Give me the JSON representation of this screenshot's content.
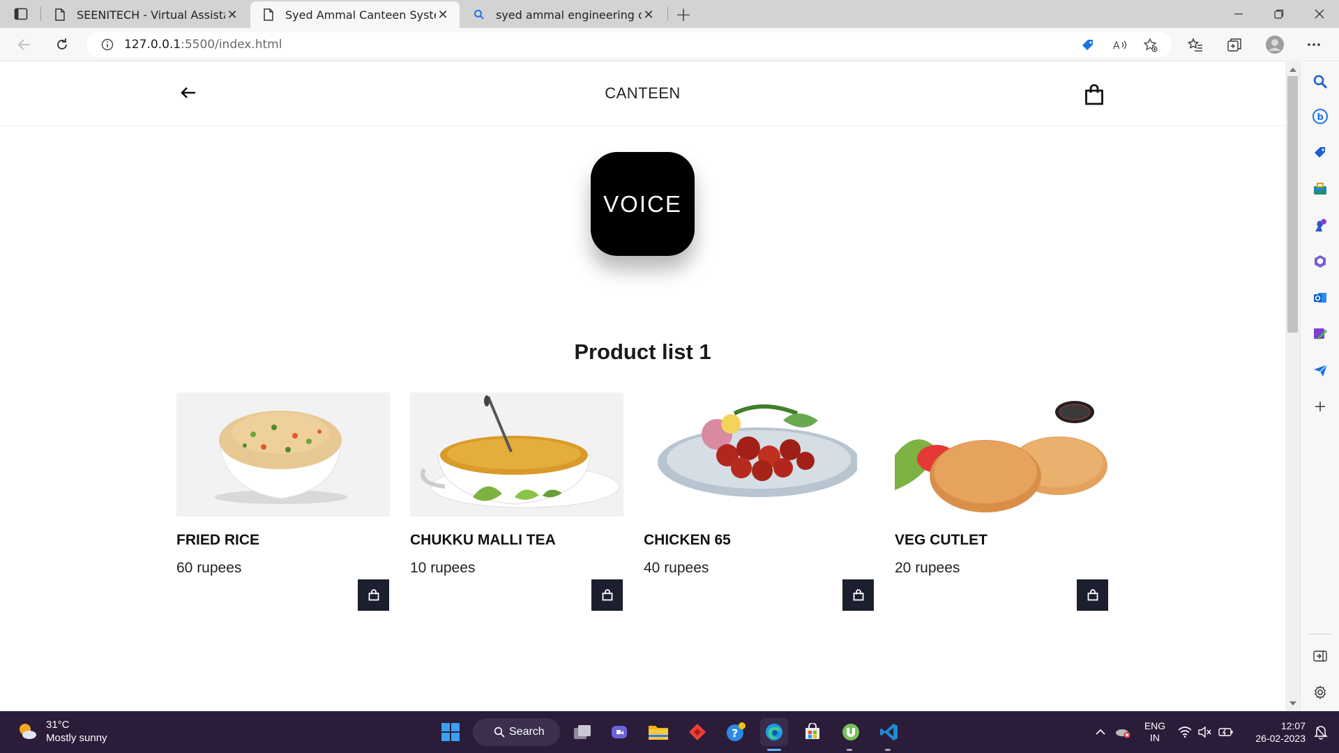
{
  "browser": {
    "tabs": [
      {
        "title": "SEENITECH - Virtual Assistant",
        "close": "✕"
      },
      {
        "title": "Syed Ammal Canteen System",
        "close": "✕"
      },
      {
        "title": "syed ammal engineering college",
        "close": "✕"
      }
    ],
    "new_tab": "+",
    "window_controls": {
      "minimize": "minimize-icon",
      "restore": "restore-icon",
      "close": "close-icon"
    },
    "address": {
      "host": "127.0.0.1",
      "path": ":5500/index.html"
    }
  },
  "page": {
    "header_title": "CANTEEN",
    "voice_button": "VOICE",
    "section_title": "Product list 1",
    "products": [
      {
        "name": "FRIED RICE",
        "price": "60 rupees",
        "image": "fried-rice-image"
      },
      {
        "name": "CHUKKU MALLI TEA",
        "price": "10 rupees",
        "image": "tea-cup-image"
      },
      {
        "name": "CHICKEN 65",
        "price": "40 rupees",
        "image": "chicken-65-image"
      },
      {
        "name": "VEG CUTLET",
        "price": "20 rupees",
        "image": "veg-cutlet-image"
      }
    ]
  },
  "taskbar": {
    "weather": {
      "temp": "31°C",
      "condition": "Mostly sunny"
    },
    "search_label": "Search",
    "language": {
      "line1": "ENG",
      "line2": "IN"
    },
    "clock": {
      "time": "12:07",
      "date": "26-02-2023"
    }
  },
  "colors": {
    "accent": "#1b1f2e",
    "voice_bg": "#000000",
    "taskbar_bg": "#2b1d3a"
  }
}
